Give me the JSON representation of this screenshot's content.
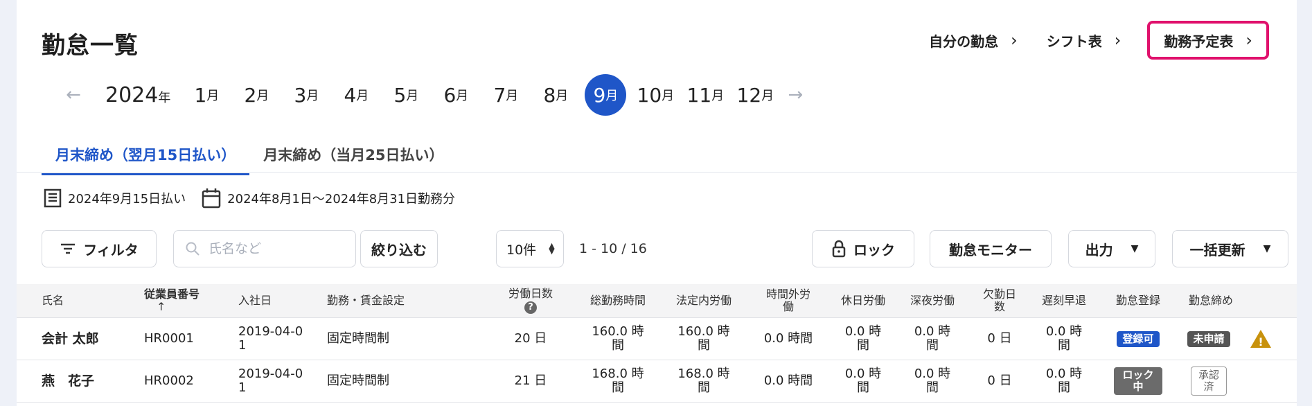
{
  "page_title": "勤怠一覧",
  "top_links": [
    "自分の勤怠",
    "シフト表",
    "勤務予定表"
  ],
  "year": {
    "num": "2024",
    "unit": "年"
  },
  "months": [
    {
      "num": "1",
      "unit": "月"
    },
    {
      "num": "2",
      "unit": "月"
    },
    {
      "num": "3",
      "unit": "月"
    },
    {
      "num": "4",
      "unit": "月"
    },
    {
      "num": "5",
      "unit": "月"
    },
    {
      "num": "6",
      "unit": "月"
    },
    {
      "num": "7",
      "unit": "月"
    },
    {
      "num": "8",
      "unit": "月"
    },
    {
      "num": "9",
      "unit": "月"
    },
    {
      "num": "10",
      "unit": "月"
    },
    {
      "num": "11",
      "unit": "月"
    },
    {
      "num": "12",
      "unit": "月"
    }
  ],
  "selected_month": "9",
  "tabs": [
    "月末締め（翌月15日払い）",
    "月末締め（当月25日払い）"
  ],
  "pay_date": "2024年9月15日払い",
  "work_period": "2024年8月1日〜2024年8月31日勤務分",
  "toolbar": {
    "filter_label": "フィルタ",
    "search_placeholder": "氏名など",
    "narrow_label": "絞り込む",
    "per_page": "10件",
    "range": "1 - 10 / 16",
    "lock_label": "ロック",
    "monitor_label": "勤怠モニター",
    "output_label": "出力",
    "bulk_update_label": "一括更新"
  },
  "columns": {
    "name": "氏名",
    "employee_no": "従業員番号",
    "sort_arrow": "↑",
    "hire_date": "入社日",
    "wage_setting": "勤務・賃金設定",
    "work_days": "労働日数",
    "help": "?",
    "total_hours": "総勤務時間",
    "statutory": "法定内労働",
    "overtime_1": "時間外労",
    "overtime_2": "働",
    "holiday": "休日労働",
    "late_night": "深夜労働",
    "absent_1": "欠勤日",
    "absent_2": "数",
    "late_early": "遅刻早退",
    "registration": "勤怠登録",
    "closing": "勤怠締め"
  },
  "rows": [
    {
      "name": "会計 太郎",
      "employee_no": "HR0001",
      "hire_date_1": "2019-04-0",
      "hire_date_2": "1",
      "wage_setting": "固定時間制",
      "work_days": "20 日",
      "total_hours_1": "160.0 時",
      "total_hours_2": "間",
      "statutory_1": "160.0 時",
      "statutory_2": "間",
      "overtime": "0.0 時間",
      "holiday_1": "0.0 時",
      "holiday_2": "間",
      "late_night_1": "0.0 時",
      "late_night_2": "間",
      "absent": "0 日",
      "late_early_1": "0.0 時",
      "late_early_2": "間",
      "registration": "登録可",
      "closing": "未申請",
      "warning": "!"
    },
    {
      "name": "燕　花子",
      "employee_no": "HR0002",
      "hire_date_1": "2019-04-0",
      "hire_date_2": "1",
      "wage_setting": "固定時間制",
      "work_days": "21 日",
      "total_hours_1": "168.0 時",
      "total_hours_2": "間",
      "statutory_1": "168.0 時",
      "statutory_2": "間",
      "overtime": "0.0 時間",
      "holiday_1": "0.0 時",
      "holiday_2": "間",
      "late_night_1": "0.0 時",
      "late_night_2": "間",
      "absent": "0 日",
      "late_early_1": "0.0 時",
      "late_early_2": "間",
      "registration_1": "ロック",
      "registration_2": "中",
      "closing_1": "承認",
      "closing_2": "済"
    }
  ]
}
